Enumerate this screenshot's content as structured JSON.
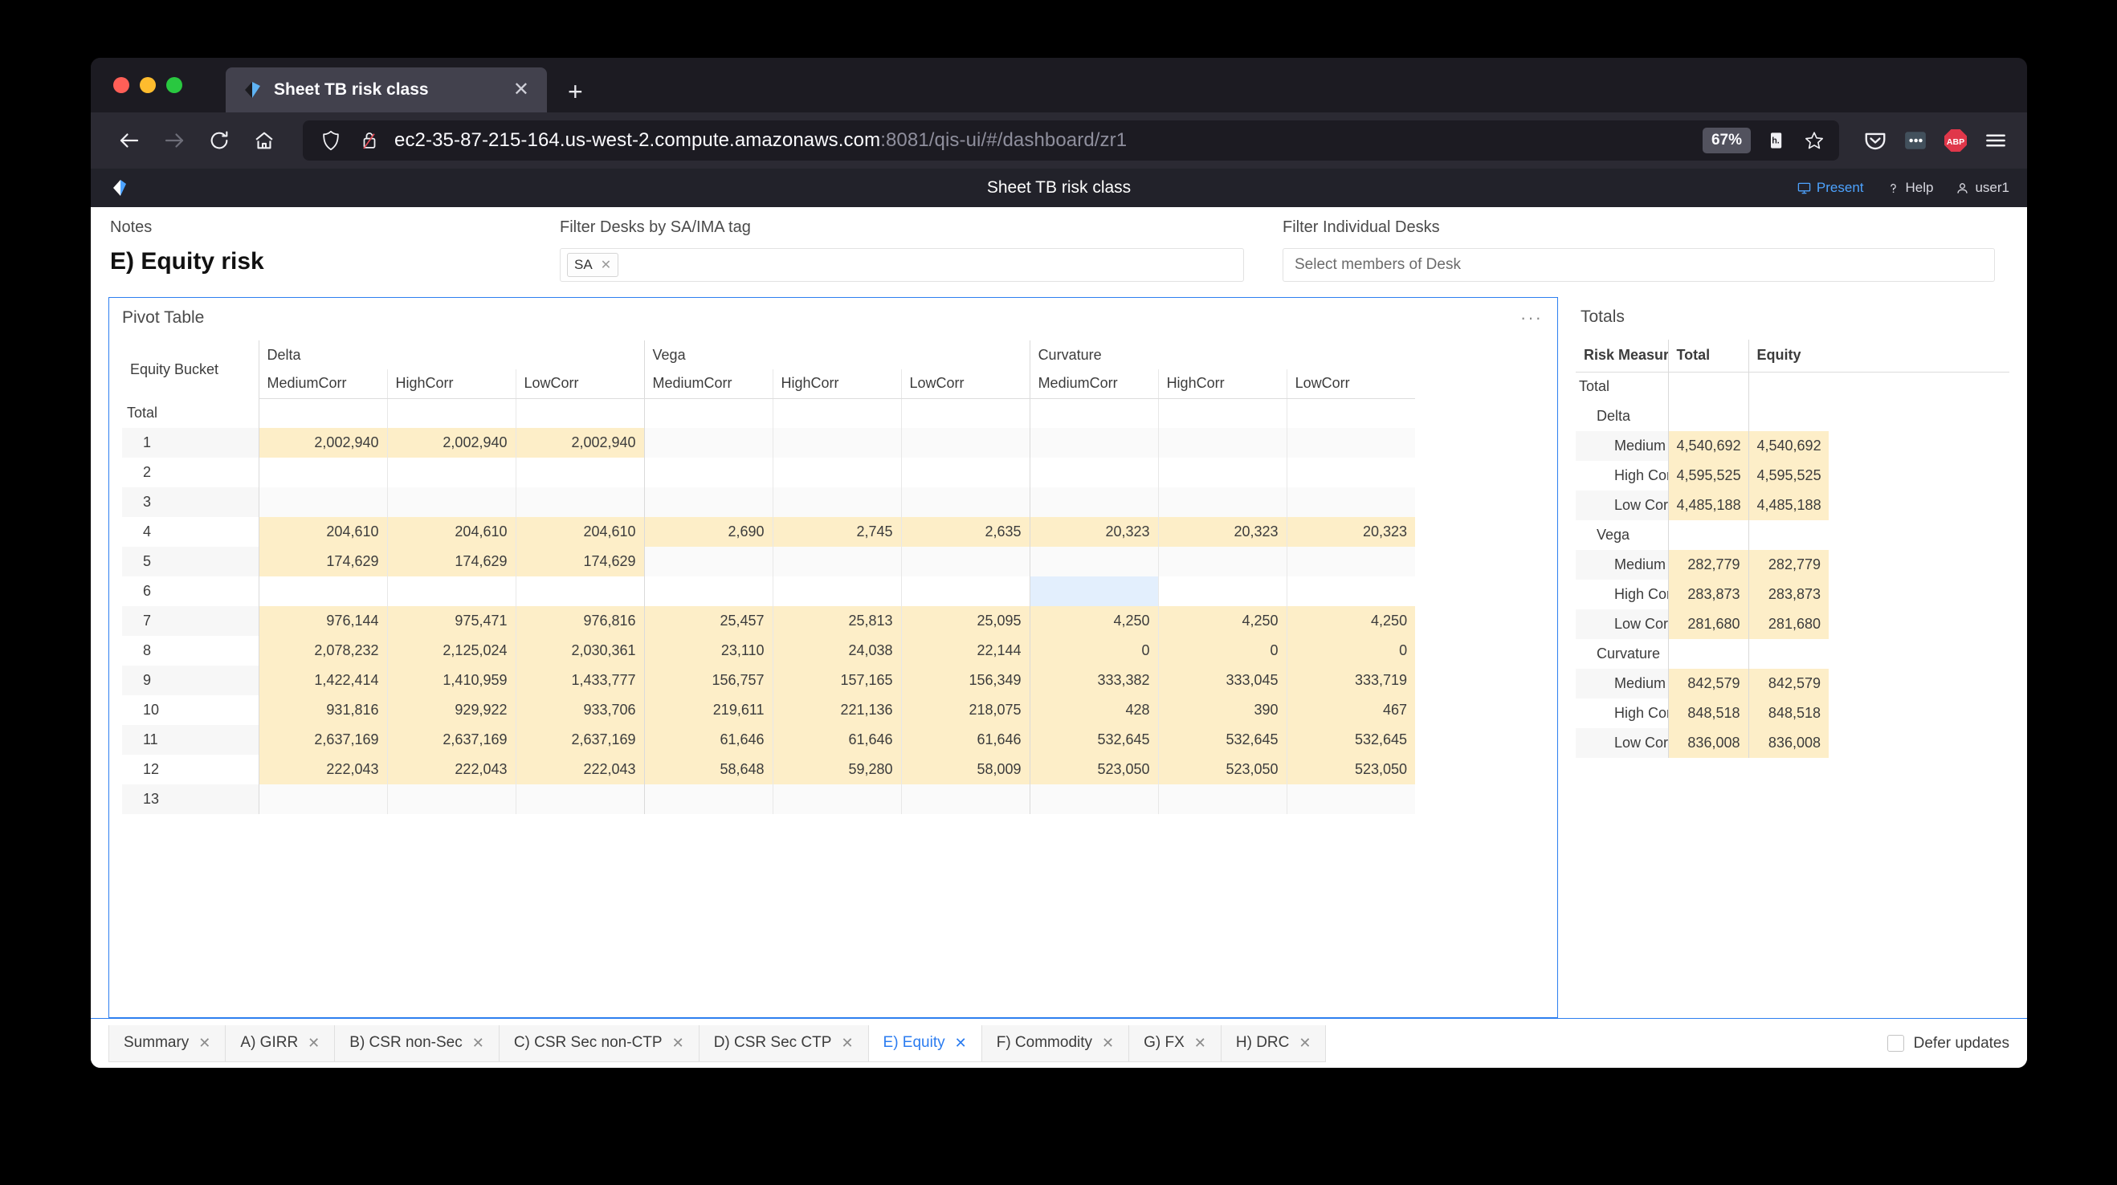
{
  "browser": {
    "tab": {
      "title": "Sheet TB risk class",
      "close_label": "✕"
    },
    "new_tab_label": "+",
    "url_main": "ec2-35-87-215-164.us-west-2.compute.amazonaws.com",
    "url_dim": ":8081/qis-ui/#/dashboard/zr1",
    "zoom_level": "67%",
    "extension_abp": "ABP"
  },
  "app": {
    "title": "Sheet TB risk class",
    "header_links": [
      {
        "label": "Present",
        "icon": "present-icon"
      },
      {
        "label": "Help",
        "icon": "question-mark-icon"
      },
      {
        "label": "user1",
        "icon": "user-icon"
      }
    ]
  },
  "filters": {
    "notes_label": "Notes",
    "notes_title": "E) Equity risk",
    "desks_tag_label": "Filter Desks by SA/IMA tag",
    "desks_tag_chip": "SA",
    "chip_remove": "✕",
    "individual_label": "Filter Individual Desks",
    "individual_placeholder": "Select members of Desk"
  },
  "pivot": {
    "title": "Pivot Table",
    "kebab": "···",
    "row_header": "Equity Bucket",
    "groups": [
      "Delta",
      "Vega",
      "Curvature"
    ],
    "sub_headers": [
      "MediumCorr",
      "HighCorr",
      "LowCorr"
    ],
    "rows": [
      {
        "label": "Total",
        "values": [
          "",
          "",
          "",
          "",
          "",
          "",
          "",
          "",
          ""
        ]
      },
      {
        "label": "1",
        "values": [
          "2,002,940",
          "2,002,940",
          "2,002,940",
          "",
          "",
          "",
          "",
          "",
          ""
        ]
      },
      {
        "label": "2",
        "values": [
          "",
          "",
          "",
          "",
          "",
          "",
          "",
          "",
          ""
        ]
      },
      {
        "label": "3",
        "values": [
          "",
          "",
          "",
          "",
          "",
          "",
          "",
          "",
          ""
        ]
      },
      {
        "label": "4",
        "values": [
          "204,610",
          "204,610",
          "204,610",
          "2,690",
          "2,745",
          "2,635",
          "20,323",
          "20,323",
          "20,323"
        ]
      },
      {
        "label": "5",
        "values": [
          "174,629",
          "174,629",
          "174,629",
          "",
          "",
          "",
          "",
          "",
          ""
        ]
      },
      {
        "label": "6",
        "values": [
          "",
          "",
          "",
          "",
          "",
          "",
          "",
          "",
          ""
        ]
      },
      {
        "label": "7",
        "values": [
          "976,144",
          "975,471",
          "976,816",
          "25,457",
          "25,813",
          "25,095",
          "4,250",
          "4,250",
          "4,250"
        ]
      },
      {
        "label": "8",
        "values": [
          "2,078,232",
          "2,125,024",
          "2,030,361",
          "23,110",
          "24,038",
          "22,144",
          "0",
          "0",
          "0"
        ]
      },
      {
        "label": "9",
        "values": [
          "1,422,414",
          "1,410,959",
          "1,433,777",
          "156,757",
          "157,165",
          "156,349",
          "333,382",
          "333,045",
          "333,719"
        ]
      },
      {
        "label": "10",
        "values": [
          "931,816",
          "929,922",
          "933,706",
          "219,611",
          "221,136",
          "218,075",
          "428",
          "390",
          "467"
        ]
      },
      {
        "label": "11",
        "values": [
          "2,637,169",
          "2,637,169",
          "2,637,169",
          "61,646",
          "61,646",
          "61,646",
          "532,645",
          "532,645",
          "532,645"
        ]
      },
      {
        "label": "12",
        "values": [
          "222,043",
          "222,043",
          "222,043",
          "58,648",
          "59,280",
          "58,009",
          "523,050",
          "523,050",
          "523,050"
        ]
      },
      {
        "label": "13",
        "values": [
          "",
          "",
          "",
          "",
          "",
          "",
          "",
          "",
          ""
        ]
      }
    ],
    "selected_cell": {
      "row": 6,
      "col": 6
    }
  },
  "totals": {
    "title": "Totals",
    "headers": [
      "Risk Measure / Meą",
      "Total",
      "Equity"
    ],
    "rows": [
      {
        "label": "Total",
        "indent": 0,
        "total": "",
        "equity": ""
      },
      {
        "label": "Delta",
        "indent": 1,
        "total": "",
        "equity": ""
      },
      {
        "label": "Medium Correl",
        "indent": 2,
        "total": "4,540,692",
        "equity": "4,540,692"
      },
      {
        "label": "High Correlatio",
        "indent": 2,
        "total": "4,595,525",
        "equity": "4,595,525"
      },
      {
        "label": "Low Correlatio",
        "indent": 2,
        "total": "4,485,188",
        "equity": "4,485,188"
      },
      {
        "label": "Vega",
        "indent": 1,
        "total": "",
        "equity": ""
      },
      {
        "label": "Medium Correl",
        "indent": 2,
        "total": "282,779",
        "equity": "282,779"
      },
      {
        "label": "High Correlatio",
        "indent": 2,
        "total": "283,873",
        "equity": "283,873"
      },
      {
        "label": "Low Correlatio",
        "indent": 2,
        "total": "281,680",
        "equity": "281,680"
      },
      {
        "label": "Curvature",
        "indent": 1,
        "total": "",
        "equity": ""
      },
      {
        "label": "Medium Correl",
        "indent": 2,
        "total": "842,579",
        "equity": "842,579"
      },
      {
        "label": "High Correlatio",
        "indent": 2,
        "total": "848,518",
        "equity": "848,518"
      },
      {
        "label": "Low Correlatio",
        "indent": 2,
        "total": "836,008",
        "equity": "836,008"
      }
    ]
  },
  "sheet_tabs": [
    {
      "label": "Summary",
      "active": false
    },
    {
      "label": "A) GIRR",
      "active": false
    },
    {
      "label": "B) CSR non-Sec",
      "active": false
    },
    {
      "label": "C) CSR Sec non-CTP",
      "active": false
    },
    {
      "label": "D) CSR Sec CTP",
      "active": false
    },
    {
      "label": "E) Equity",
      "active": true
    },
    {
      "label": "F) Commodity",
      "active": false
    },
    {
      "label": "G) FX",
      "active": false
    },
    {
      "label": "H) DRC",
      "active": false
    }
  ],
  "tab_close_glyph": "✕",
  "defer_updates_label": "Defer updates",
  "colors": {
    "accent": "#2d7ff0",
    "highlight_cell": "#fdeec8",
    "selected_cell": "#e3effd",
    "browser_chrome": "#2b2a33"
  }
}
